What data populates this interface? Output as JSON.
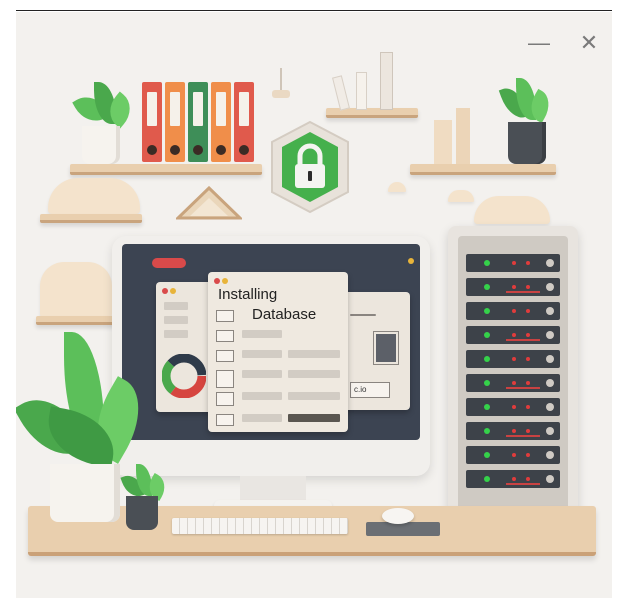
{
  "window_controls": {
    "minimize": "—",
    "close": "✕"
  },
  "installer": {
    "title_line1": "Installing",
    "title_line2": "Database"
  },
  "small_panel": {
    "label": "c.io"
  },
  "icons": [
    "padlock-icon",
    "server-rack",
    "monitor",
    "keyboard",
    "mouse",
    "plant",
    "binders",
    "window-dots"
  ],
  "colors": {
    "background": "#f3f1ee",
    "screen": "#3c4452",
    "shield": "#45b04c",
    "led_green": "#35d24a",
    "led_red": "#e03c3c",
    "binder_red": "#e05a4c",
    "binder_orange": "#f08e4a",
    "binder_green": "#3e8e58"
  }
}
